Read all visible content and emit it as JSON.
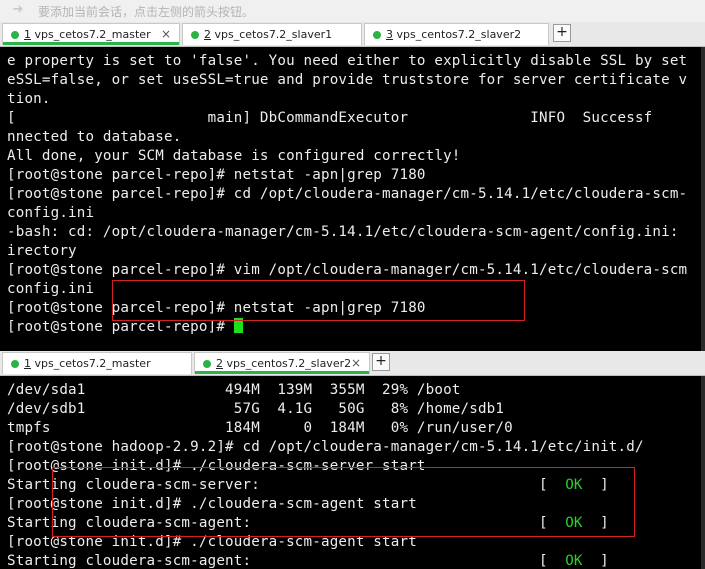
{
  "hint": {
    "icon": "arrow-icon",
    "text": "要添加当前会话，点击左侧的箭头按钮。"
  },
  "top_pane": {
    "tabs": [
      {
        "number": "1",
        "label": "vps_cetos7.2_master",
        "active": true
      },
      {
        "number": "2",
        "label": "vps_cetos7.2_slaver1",
        "active": false
      },
      {
        "number": "3",
        "label": "vps_centos7.2_slaver2",
        "active": false
      }
    ],
    "add_label": "+",
    "close_label": "×",
    "lines": [
      "e property is set to 'false'. You need either to explicitly disable SSL by set",
      "eSSL=false, or set useSSL=true and provide truststore for server certificate v",
      "tion.",
      "[                      main] DbCommandExecutor              INFO  Successf",
      "nnected to database.",
      "All done, your SCM database is configured correctly!",
      "[root@stone parcel-repo]# netstat -apn|grep 7180",
      "[root@stone parcel-repo]# cd /opt/cloudera-manager/cm-5.14.1/etc/cloudera-scm-",
      "config.ini",
      "-bash: cd: /opt/cloudera-manager/cm-5.14.1/etc/cloudera-scm-agent/config.ini: ",
      "irectory",
      "[root@stone parcel-repo]# vim /opt/cloudera-manager/cm-5.14.1/etc/cloudera-scm",
      "config.ini",
      "[root@stone parcel-repo]# netstat -apn|grep 7180",
      "[root@stone parcel-repo]# "
    ]
  },
  "bottom_pane": {
    "tabs": [
      {
        "number": "1",
        "label": "vps_cetos7.2_master",
        "active": false
      },
      {
        "number": "2",
        "label": "vps_centos7.2_slaver2",
        "active": true
      }
    ],
    "add_label": "+",
    "close_label": "×",
    "lines": [
      "/dev/sda1                494M  139M  355M  29% /boot",
      "/dev/sdb1                 57G  4.1G   50G   8% /home/sdb1",
      "tmpfs                    184M     0  184M   0% /run/user/0",
      "[root@stone hadoop-2.9.2]# cd /opt/cloudera-manager/cm-5.14.1/etc/init.d/",
      "[root@stone init.d]# ./cloudera-scm-server start",
      "Starting cloudera-scm-server:",
      "[root@stone init.d]# ./cloudera-scm-agent start",
      "Starting cloudera-scm-agent:",
      "[root@stone init.d]# ./cloudera-scm-agent start",
      "Starting cloudera-scm-agent:"
    ],
    "status": {
      "open": "[",
      "ok": "OK",
      "close": "]"
    }
  }
}
